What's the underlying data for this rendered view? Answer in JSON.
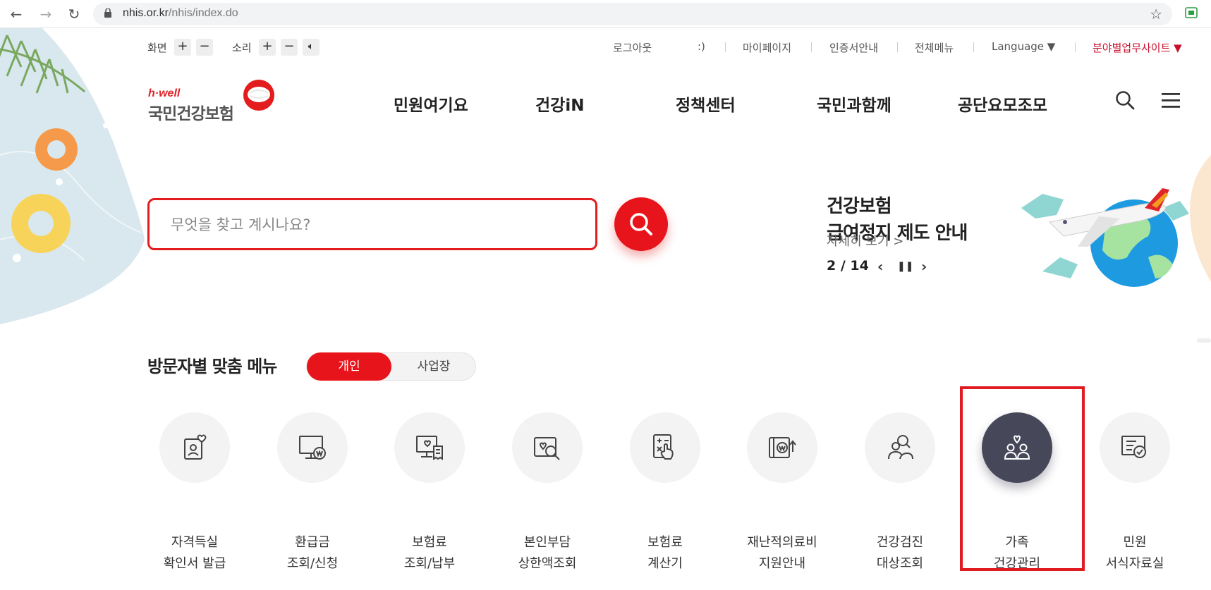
{
  "browser": {
    "url_host": "nhis.or.kr",
    "url_path": "/nhis/index.do"
  },
  "util": {
    "screen_label": "화면",
    "sound_label": "소리",
    "plus": "+",
    "minus": "−",
    "links": [
      "로그아웃",
      ":)",
      "마이페이지",
      "인증서안내",
      "전체메뉴",
      "Language ▼",
      "분야별업무사이트 ▼"
    ]
  },
  "logo": {
    "sub": "h·well",
    "main": "국민건강보험"
  },
  "gnb": {
    "items": [
      "민원여기요",
      "건강iN",
      "정책센터",
      "국민과함께",
      "공단요모조모"
    ]
  },
  "search": {
    "placeholder": "무엇을 찾고 계시나요?"
  },
  "banner": {
    "title_line1": "건강보험",
    "title_line2": "급여정지 제도 안내",
    "more": "자세히 보기 >",
    "page": "2 / 14",
    "prev": "‹",
    "pause": "❚❚",
    "next": "›"
  },
  "visitor": {
    "title": "방문자별 맞춤 메뉴",
    "tab_personal": "개인",
    "tab_business": "사업장"
  },
  "menu": {
    "items": [
      {
        "line1": "자격득실",
        "line2": "확인서 발급",
        "icon": "id-card-heart-icon"
      },
      {
        "line1": "환급금",
        "line2": "조회/신청",
        "icon": "monitor-won-icon"
      },
      {
        "line1": "보험료",
        "line2": "조회/납부",
        "icon": "monitor-receipt-icon"
      },
      {
        "line1": "본인부담",
        "line2": "상한액조회",
        "icon": "heart-search-icon"
      },
      {
        "line1": "보험료",
        "line2": "계산기",
        "icon": "calculator-hand-icon"
      },
      {
        "line1": "재난적의료비",
        "line2": "지원안내",
        "icon": "wallet-won-arrow-icon"
      },
      {
        "line1": "건강검진",
        "line2": "대상조회",
        "icon": "people-search-icon"
      },
      {
        "line1": "가족",
        "line2": "건강관리",
        "icon": "family-heart-icon",
        "active": true
      },
      {
        "line1": "민원",
        "line2": "서식자료실",
        "icon": "document-check-icon"
      }
    ]
  }
}
